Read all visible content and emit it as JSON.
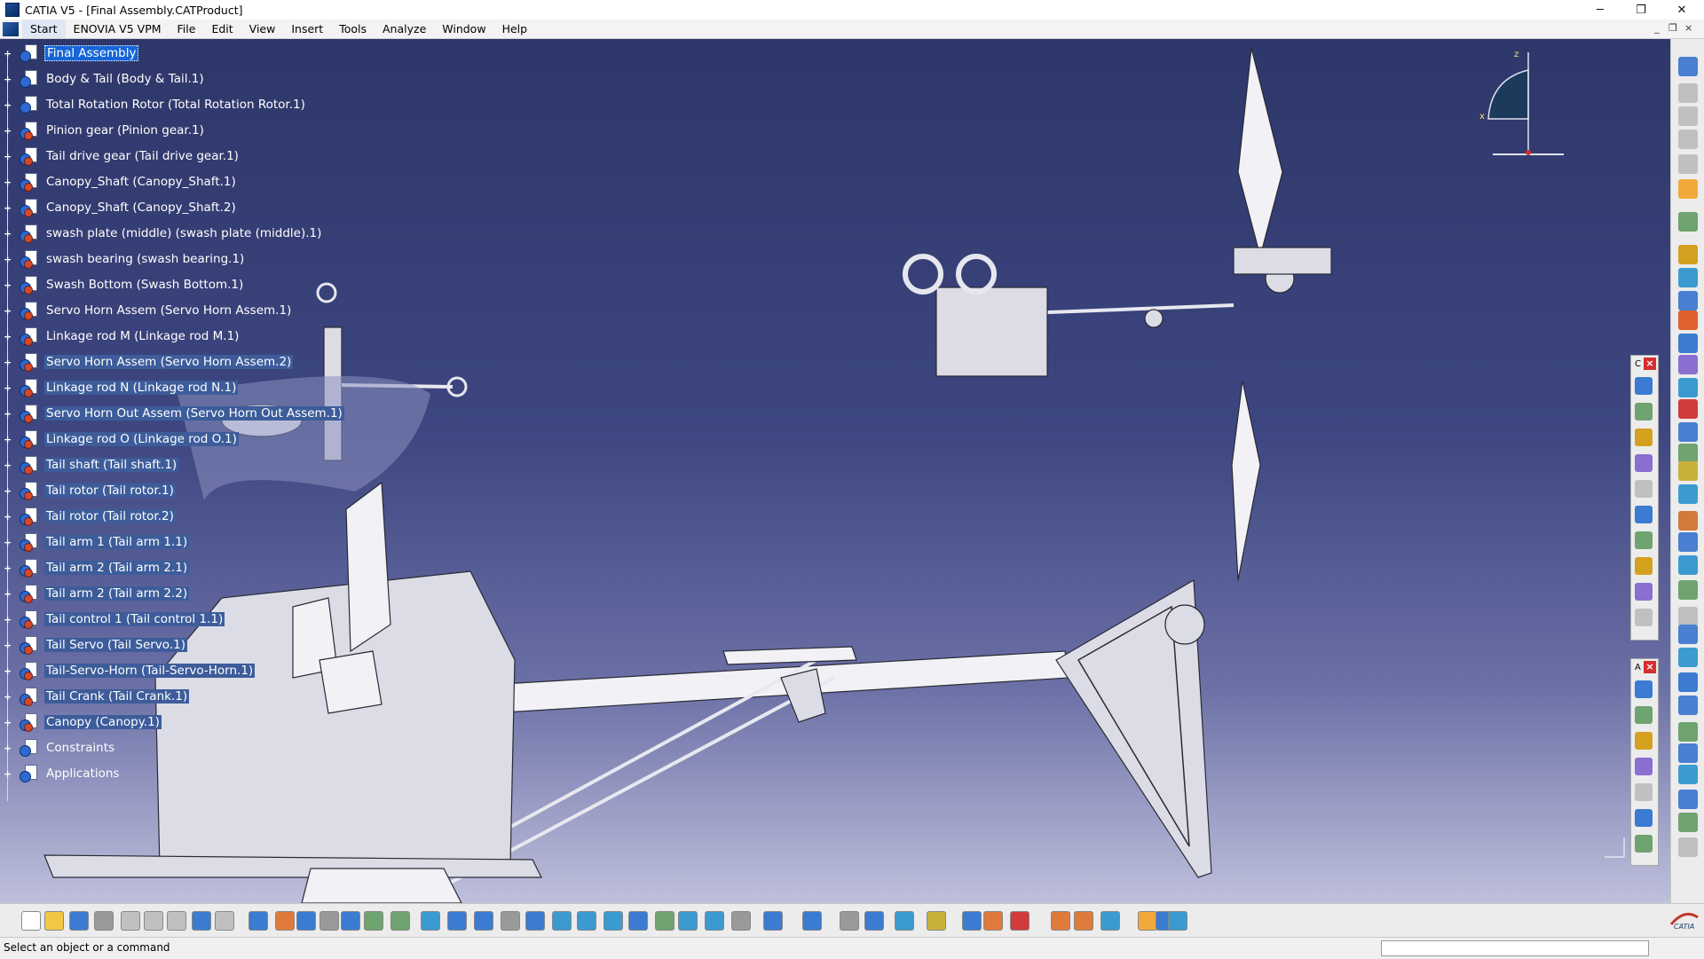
{
  "window": {
    "title": "CATIA V5 - [Final Assembly.CATProduct]",
    "controls": [
      "─",
      "❐",
      "✕"
    ]
  },
  "menu": {
    "items": [
      "Start",
      "ENOVIA V5 VPM",
      "File",
      "Edit",
      "View",
      "Insert",
      "Tools",
      "Analyze",
      "Window",
      "Help"
    ],
    "doc_controls": [
      "_",
      "❐",
      "×"
    ]
  },
  "tree": {
    "root": "Final Assembly",
    "nodes": [
      "Body & Tail (Body & Tail.1)",
      "Total Rotation Rotor (Total Rotation Rotor.1)",
      "Pinion gear (Pinion gear.1)",
      "Tail drive gear (Tail drive gear.1)",
      "Canopy_Shaft (Canopy_Shaft.1)",
      "Canopy_Shaft (Canopy_Shaft.2)",
      "swash plate (middle) (swash plate (middle).1)",
      "swash bearing (swash bearing.1)",
      "Swash Bottom (Swash Bottom.1)",
      "Servo Horn Assem (Servo Horn Assem.1)",
      "Linkage rod M (Linkage rod M.1)",
      "Servo Horn Assem (Servo Horn Assem.2)",
      "Linkage rod N (Linkage rod N.1)",
      "Servo Horn Out Assem (Servo Horn Out Assem.1)",
      "Linkage rod O (Linkage rod O.1)",
      "Tail shaft (Tail shaft.1)",
      "Tail rotor (Tail rotor.1)",
      "Tail rotor (Tail rotor.2)",
      "Tail arm 1 (Tail arm 1.1)",
      "Tail arm 2 (Tail arm 2.1)",
      "Tail arm 2 (Tail arm 2.2)",
      "Tail control 1 (Tail control 1.1)",
      "Tail Servo (Tail Servo.1)",
      "Tail-Servo-Horn (Tail-Servo-Horn.1)",
      "Tail Crank (Tail Crank.1)",
      "Canopy (Canopy.1)"
    ],
    "extra": [
      "Constraints",
      "Applications"
    ]
  },
  "compass": {
    "z": "z",
    "x": "x"
  },
  "status": {
    "prompt": "Select an object or a command"
  },
  "palettes": {
    "upper_letter": "C",
    "lower_letter": "A"
  },
  "brand": {
    "logo_text": "CATIA"
  },
  "colors": {
    "accent": "#1565d6",
    "viewport_top": "#2e3769",
    "viewport_bottom": "#bfc0dc"
  }
}
